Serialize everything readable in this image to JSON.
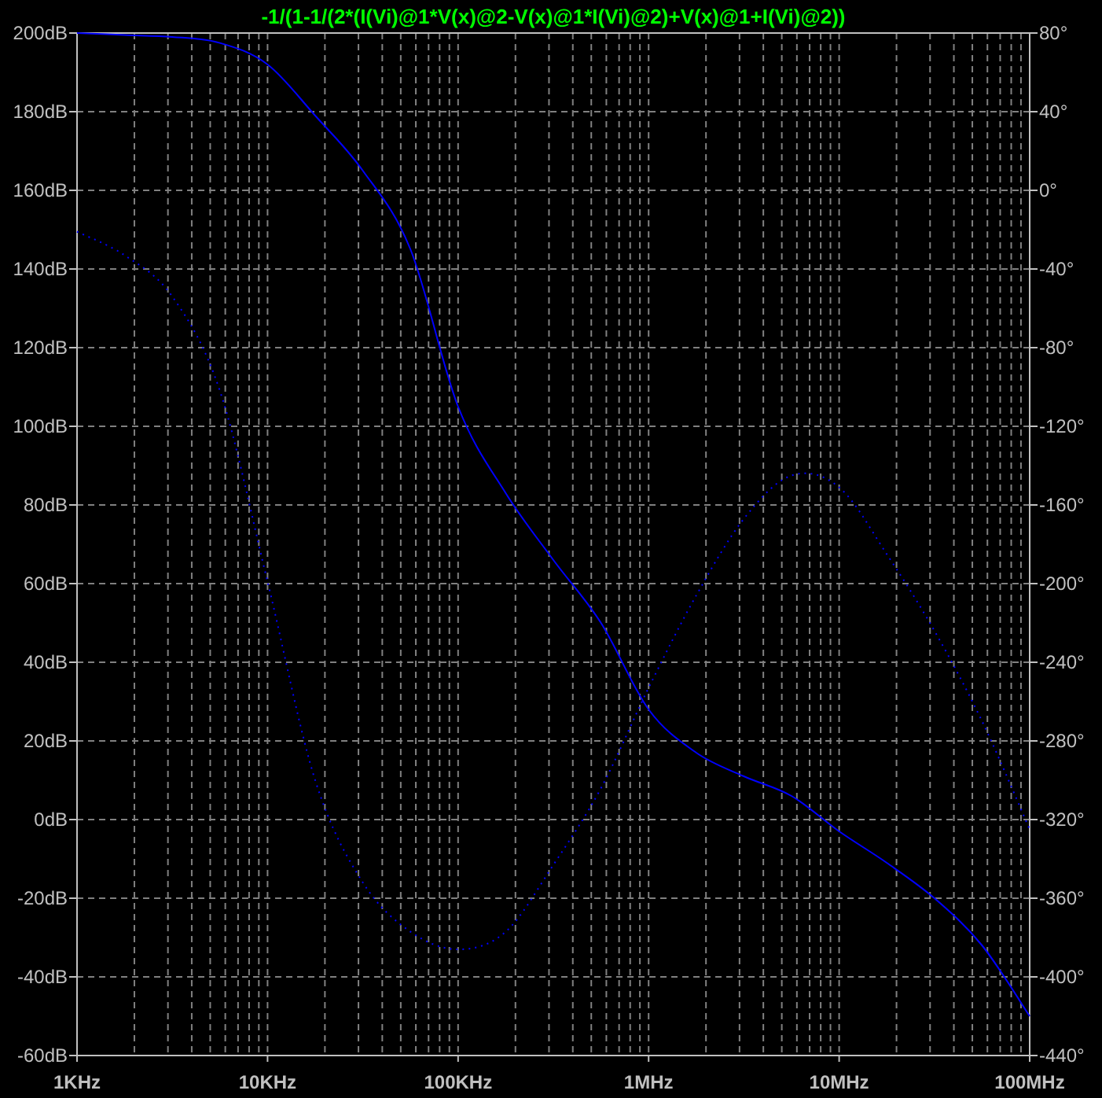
{
  "chart_data": {
    "type": "line",
    "title": "-1/(1-1/(2*(I(Vi)@1*V(x)@2-V(x)@1*I(Vi)@2)+V(x)@1+I(Vi)@2))",
    "categories": [
      "1KHz",
      null,
      null,
      null,
      "10KHz",
      null,
      null,
      null,
      "100KHz",
      null,
      null,
      null,
      "1MHz",
      null,
      null,
      null,
      "10MHz",
      null,
      null,
      null,
      "100MHz"
    ],
    "grid": true,
    "ylim": [
      -60,
      200
    ],
    "y2lim": [
      -440,
      80
    ],
    "yticks": [
      {
        "value": 200,
        "label": "200dB"
      },
      {
        "value": 180,
        "label": "180dB"
      },
      {
        "value": 160,
        "label": "160dB"
      },
      {
        "value": 140,
        "label": "140dB"
      },
      {
        "value": 120,
        "label": "120dB"
      },
      {
        "value": 100,
        "label": "100dB"
      },
      {
        "value": 80,
        "label": "80dB"
      },
      {
        "value": 60,
        "label": "60dB"
      },
      {
        "value": 40,
        "label": "40dB"
      },
      {
        "value": 20,
        "label": "20dB"
      },
      {
        "value": 0,
        "label": "0dB"
      },
      {
        "value": -20,
        "label": "-20dB"
      },
      {
        "value": -40,
        "label": "-40dB"
      },
      {
        "value": -60,
        "label": "-60dB"
      }
    ],
    "y2ticks": [
      {
        "value": 80,
        "label": "80°"
      },
      {
        "value": 40,
        "label": "40°"
      },
      {
        "value": 0,
        "label": "0°"
      },
      {
        "value": -40,
        "label": "-40°"
      },
      {
        "value": -80,
        "label": "-80°"
      },
      {
        "value": -120,
        "label": "-120°"
      },
      {
        "value": -160,
        "label": "-160°"
      },
      {
        "value": -200,
        "label": "-200°"
      },
      {
        "value": -240,
        "label": "-240°"
      },
      {
        "value": -280,
        "label": "-280°"
      },
      {
        "value": -320,
        "label": "-320°"
      },
      {
        "value": -360,
        "label": "-360°"
      },
      {
        "value": -400,
        "label": "-400°"
      },
      {
        "value": -440,
        "label": "-440°"
      }
    ],
    "series": [
      {
        "color": "#0000ff",
        "values": [
          200,
          199.5,
          199,
          197.5,
          192,
          179,
          165,
          145,
          105,
          83,
          66,
          50,
          28,
          17,
          11,
          6,
          -3,
          -11,
          -20,
          -32,
          -50
        ]
      },
      {
        "color": "#0000ff",
        "axis": "y2",
        "line_style": "dotted",
        "values": [
          -21,
          -33,
          -54,
          -102,
          -199,
          -300,
          -352,
          -377,
          -386,
          -377,
          -343,
          -304,
          -253,
          -206,
          -167,
          -145,
          -151,
          -185,
          -224,
          -270,
          -325
        ]
      }
    ]
  }
}
